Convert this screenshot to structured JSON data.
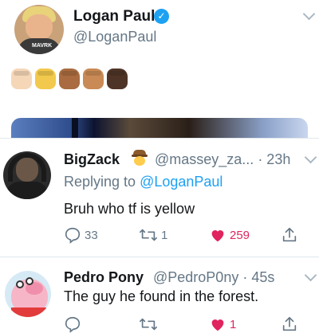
{
  "main_tweet": {
    "display_name": "Logan Paul",
    "handle": "@LoganPaul",
    "avatar_logo_text": "MAVRK",
    "emoji_skin_tones": [
      "#f5d7b8",
      "#f2c94c",
      "#a96b3f",
      "#c98a55",
      "#4e3426"
    ],
    "emoji_icon": "raised-fist-emoji"
  },
  "replies": [
    {
      "display_name": "BigZack",
      "badge_icon": "cowboy-hat-face-emoji",
      "meta": "@massey_za... · 23h",
      "replying_prefix": "Replying to",
      "replying_to": "@LoganPaul",
      "text": "Bruh who tf is yellow",
      "actions": {
        "reply_count": "33",
        "retweet_count": "1",
        "like_count": "259",
        "liked": true
      }
    },
    {
      "display_name": "Pedro Pony",
      "meta": "@PedroP0ny · 45s",
      "text": "The guy he found in the forest.",
      "actions": {
        "reply_count": "",
        "retweet_count": "",
        "like_count": "1",
        "liked": true
      }
    }
  ],
  "colors": {
    "link_blue": "#1da1f2",
    "muted_gray": "#657786",
    "like_red": "#e0245e"
  }
}
